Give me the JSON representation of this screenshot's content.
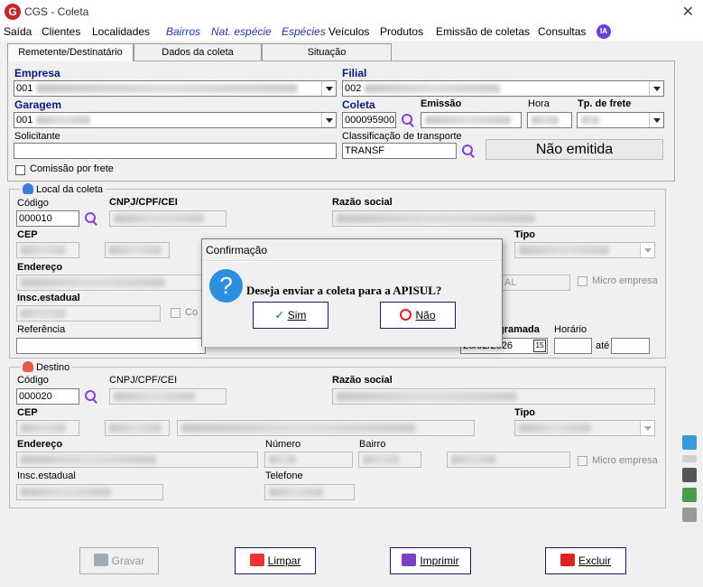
{
  "window": {
    "title": "CGS - Coleta",
    "logo": "G"
  },
  "menu": [
    "Saída",
    "Clientes",
    "Localidades",
    "Bairros",
    "Nat. espécie",
    "Espécies",
    "Veículos",
    "Produtos",
    "Emissão de coletas",
    "Consultas"
  ],
  "menu_badge": "IA",
  "tabs": [
    "Remetente/Destinatário",
    "Dados da coleta",
    "Situação"
  ],
  "form": {
    "empresa_label": "Empresa",
    "empresa_value": "001",
    "filial_label": "Filial",
    "filial_value": "002",
    "garagem_label": "Garagem",
    "garagem_value": "001",
    "coleta_label": "Coleta",
    "coleta_value": "000095900",
    "emissao_label": "Emissão",
    "hora_label": "Hora",
    "frete_label": "Tp. de frete",
    "solicitante_label": "Solicitante",
    "solicitante_value": "",
    "classificacao_label": "Classificação de transporte",
    "classificacao_value": "TRANSF",
    "status": "Não emitida",
    "comissao_label": "Comissão por frete"
  },
  "local_coleta": {
    "legend": "Local da coleta",
    "codigo_label": "Código",
    "codigo_value": "000010",
    "cnpj_label": "CNPJ/CPF/CEI",
    "razao_label": "Razão social",
    "cep_label": "CEP",
    "tipo_label": "Tipo",
    "endereco_label": "Endereço",
    "insc_label": "Insc.estadual",
    "micro_label": "Micro empresa",
    "referencia_label": "Referência",
    "programada_label": "gramada",
    "programada_value": "26/02/2026",
    "horario_label": "Horário",
    "ate_label": "até",
    "partial_text": "AL",
    "partial_check": "Co"
  },
  "destino": {
    "legend": "Destino",
    "codigo_label": "Código",
    "codigo_value": "000020",
    "cnpj_label": "CNPJ/CPF/CEI",
    "razao_label": "Razão social",
    "cep_label": "CEP",
    "tipo_label": "Tipo",
    "endereco_label": "Endereço",
    "numero_label": "Número",
    "bairro_label": "Bairro",
    "micro_label": "Micro empresa",
    "insc_label": "Insc.estadual",
    "telefone_label": "Telefone"
  },
  "buttons": {
    "gravar": "Gravar",
    "limpar": "Limpar",
    "imprimir": "Imprimir",
    "excluir": "Excluir"
  },
  "dialog": {
    "title": "Confirmação",
    "message": "Deseja enviar a coleta para a APISUL?",
    "yes": "Sim",
    "no": "Não"
  },
  "colors": {
    "accent_purple": "#8a3fd6",
    "label_blue": "#0a1a7a",
    "menu_blue": "#1e3aa8",
    "logo_red": "#c0282e"
  }
}
